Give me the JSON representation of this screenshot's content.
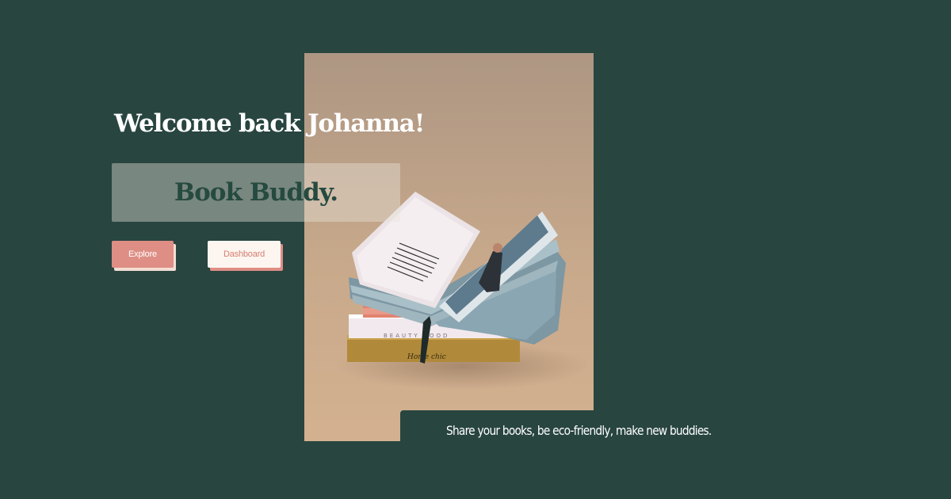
{
  "header": {
    "welcome_text": "Welcome back Johanna!"
  },
  "brand": {
    "name": "Book Buddy."
  },
  "actions": {
    "explore_label": "Explore",
    "dashboard_label": "Dashboard"
  },
  "tagline": "Share your books, be eco-friendly, make new buddies.",
  "hero_image": {
    "subject": "book-stack-photo",
    "book_spine_texts": [
      "BEAUTY FOOD",
      "Home chic"
    ]
  },
  "colors": {
    "background": "#284540",
    "accent": "#de8e85",
    "brand_text": "#264a3f",
    "light": "#fdf5f0"
  }
}
